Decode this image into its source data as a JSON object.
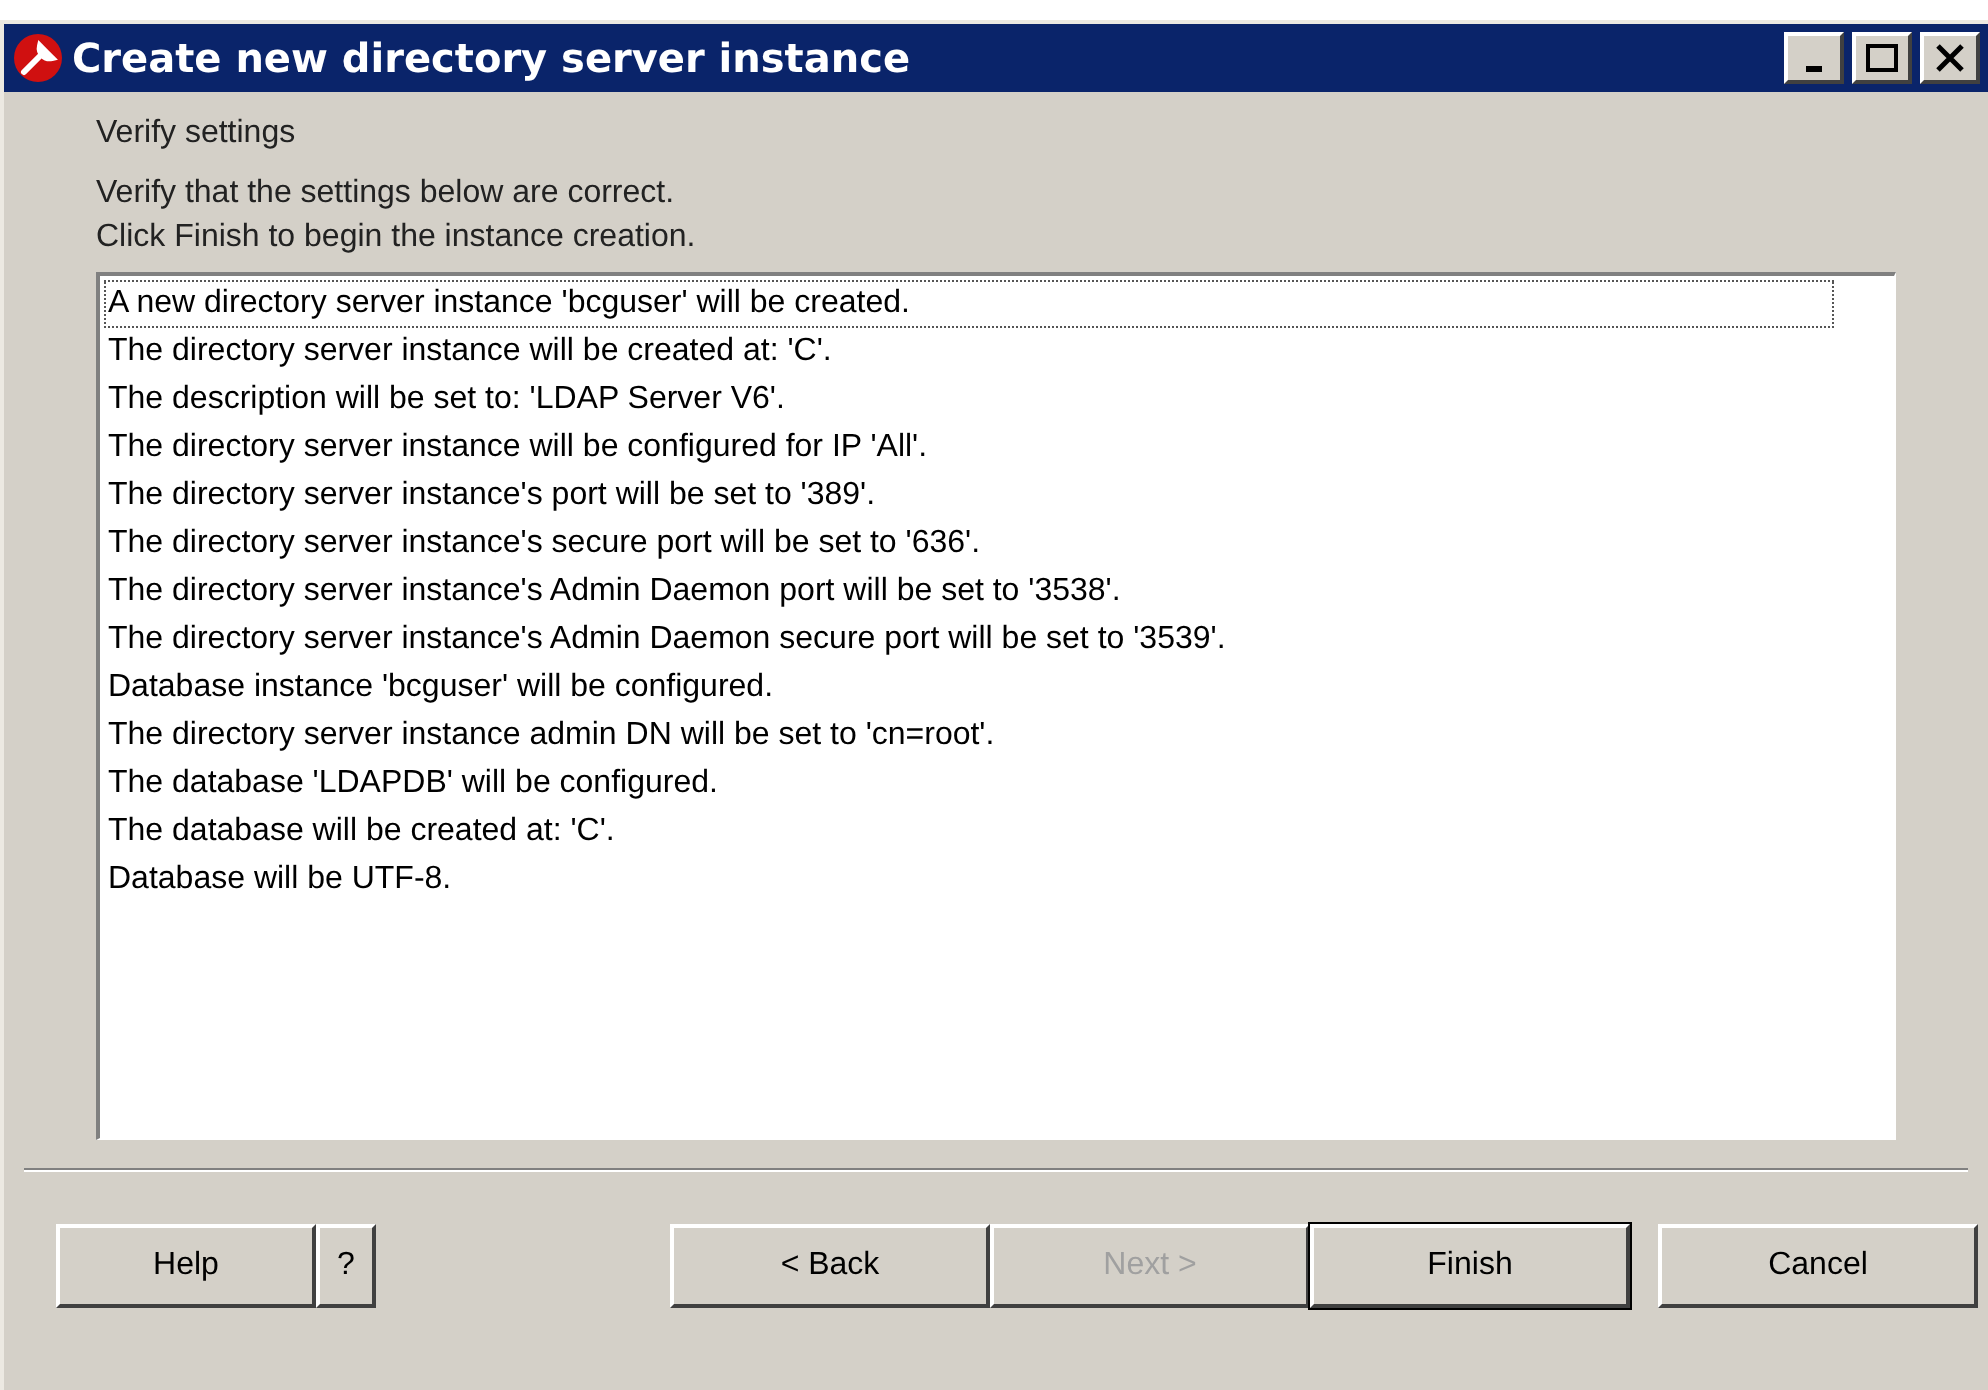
{
  "window": {
    "title": "Create new directory server instance"
  },
  "heading": "Verify settings",
  "instructions": [
    "Verify that the settings below are correct.",
    "Click Finish to begin the instance creation."
  ],
  "settings_list": [
    {
      "text": "A new directory server instance 'bcguser' will be created.",
      "selected": true
    },
    {
      "text": "The directory server instance will be created at: 'C'.",
      "selected": false
    },
    {
      "text": "The description will be set to: 'LDAP Server V6'.",
      "selected": false
    },
    {
      "text": "The directory server instance will be configured for IP 'All'.",
      "selected": false
    },
    {
      "text": "The directory server instance's port will be set to '389'.",
      "selected": false
    },
    {
      "text": "The directory server instance's secure port will be set to '636'.",
      "selected": false
    },
    {
      "text": "The directory server instance's Admin Daemon port will be set to '3538'.",
      "selected": false
    },
    {
      "text": "The directory server instance's Admin Daemon secure port will be set to '3539'.",
      "selected": false
    },
    {
      "text": "Database instance 'bcguser' will be configured.",
      "selected": false
    },
    {
      "text": "The directory server instance admin DN will be set to 'cn=root'.",
      "selected": false
    },
    {
      "text": "The database 'LDAPDB' will be configured.",
      "selected": false
    },
    {
      "text": "The database will be created at: 'C'.",
      "selected": false
    },
    {
      "text": "Database will be UTF-8.",
      "selected": false
    }
  ],
  "help_buttons": [
    {
      "label": "Help",
      "disabled": false,
      "default": false
    },
    {
      "label": "?",
      "disabled": false,
      "default": false
    }
  ],
  "nav_buttons": [
    {
      "label": "< Back",
      "disabled": false,
      "default": false
    },
    {
      "label": "Next >",
      "disabled": true,
      "default": false
    },
    {
      "label": "Finish",
      "disabled": false,
      "default": true
    }
  ],
  "cancel_buttons": [
    {
      "label": "Cancel",
      "disabled": false,
      "default": false
    }
  ]
}
